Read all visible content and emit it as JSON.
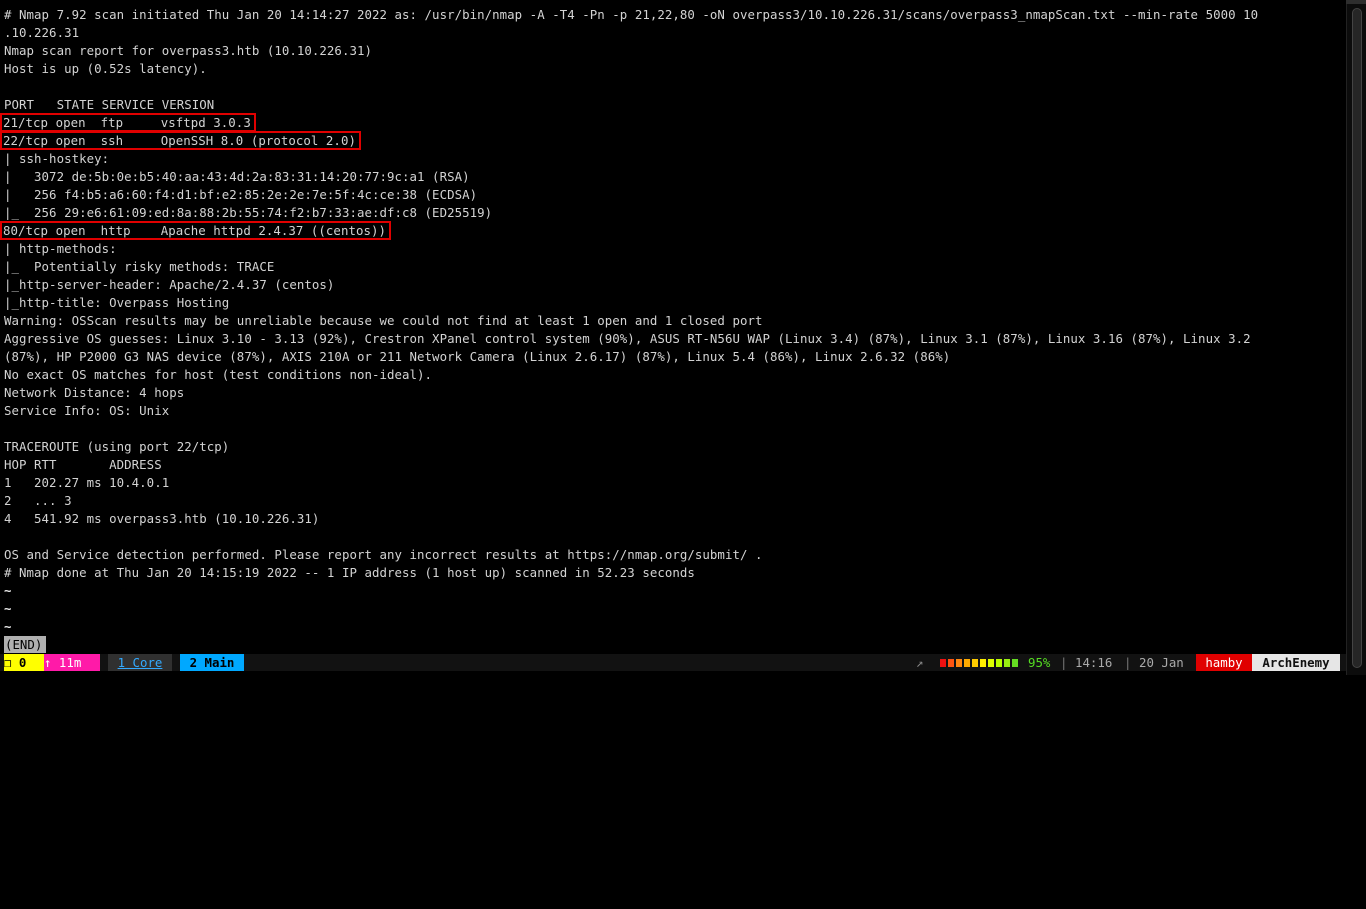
{
  "terminal": {
    "lines": [
      {
        "text": "# Nmap 7.92 scan initiated Thu Jan 20 14:14:27 2022 as: /usr/bin/nmap -A -T4 -Pn -p 21,22,80 -oN overpass3/10.10.226.31/scans/overpass3_nmapScan.txt --min-rate 5000 10",
        "highlight": false
      },
      {
        "text": ".10.226.31",
        "highlight": false
      },
      {
        "text": "Nmap scan report for overpass3.htb (10.10.226.31)",
        "highlight": false
      },
      {
        "text": "Host is up (0.52s latency).",
        "highlight": false
      },
      {
        "text": "",
        "highlight": false
      },
      {
        "text": "PORT   STATE SERVICE VERSION",
        "highlight": false
      },
      {
        "text": "21/tcp open  ftp     vsftpd 3.0.3",
        "highlight": true
      },
      {
        "text": "22/tcp open  ssh     OpenSSH 8.0 (protocol 2.0)",
        "highlight": true
      },
      {
        "text": "| ssh-hostkey: ",
        "highlight": false
      },
      {
        "text": "|   3072 de:5b:0e:b5:40:aa:43:4d:2a:83:31:14:20:77:9c:a1 (RSA)",
        "highlight": false
      },
      {
        "text": "|   256 f4:b5:a6:60:f4:d1:bf:e2:85:2e:2e:7e:5f:4c:ce:38 (ECDSA)",
        "highlight": false
      },
      {
        "text": "|_  256 29:e6:61:09:ed:8a:88:2b:55:74:f2:b7:33:ae:df:c8 (ED25519)",
        "highlight": false
      },
      {
        "text": "80/tcp open  http    Apache httpd 2.4.37 ((centos))",
        "highlight": true
      },
      {
        "text": "| http-methods: ",
        "highlight": false
      },
      {
        "text": "|_  Potentially risky methods: TRACE",
        "highlight": false
      },
      {
        "text": "|_http-server-header: Apache/2.4.37 (centos)",
        "highlight": false
      },
      {
        "text": "|_http-title: Overpass Hosting",
        "highlight": false
      },
      {
        "text": "Warning: OSScan results may be unreliable because we could not find at least 1 open and 1 closed port",
        "highlight": false
      },
      {
        "text": "Aggressive OS guesses: Linux 3.10 - 3.13 (92%), Crestron XPanel control system (90%), ASUS RT-N56U WAP (Linux 3.4) (87%), Linux 3.1 (87%), Linux 3.16 (87%), Linux 3.2",
        "highlight": false
      },
      {
        "text": "(87%), HP P2000 G3 NAS device (87%), AXIS 210A or 211 Network Camera (Linux 2.6.17) (87%), Linux 5.4 (86%), Linux 2.6.32 (86%)",
        "highlight": false
      },
      {
        "text": "No exact OS matches for host (test conditions non-ideal).",
        "highlight": false
      },
      {
        "text": "Network Distance: 4 hops",
        "highlight": false
      },
      {
        "text": "Service Info: OS: Unix",
        "highlight": false
      },
      {
        "text": "",
        "highlight": false
      },
      {
        "text": "TRACEROUTE (using port 22/tcp)",
        "highlight": false
      },
      {
        "text": "HOP RTT       ADDRESS",
        "highlight": false
      },
      {
        "text": "1   202.27 ms 10.4.0.1",
        "highlight": false
      },
      {
        "text": "2   ... 3",
        "highlight": false
      },
      {
        "text": "4   541.92 ms overpass3.htb (10.10.226.31)",
        "highlight": false
      },
      {
        "text": "",
        "highlight": false
      },
      {
        "text": "OS and Service detection performed. Please report any incorrect results at https://nmap.org/submit/ .",
        "highlight": false
      },
      {
        "text": "# Nmap done at Thu Jan 20 14:15:19 2022 -- 1 IP address (1 host up) scanned in 52.23 seconds",
        "highlight": false
      },
      {
        "text": "~",
        "highlight": false,
        "tilde": true
      },
      {
        "text": "~",
        "highlight": false,
        "tilde": true
      },
      {
        "text": "~",
        "highlight": false,
        "tilde": true
      }
    ],
    "pager_status": "(END)"
  },
  "statusbar": {
    "zero_icon": "window-icon",
    "zero_label": "❒ 0",
    "uptime_label": "↑ 11m",
    "window1_label": "1 Core",
    "window2_label": "2 Main",
    "arrow_glyph": "↗",
    "battery_percent": "95%",
    "battery_level": 0.95,
    "battery_cell_colors": [
      "#ee1111",
      "#ff5511",
      "#ff8811",
      "#ffaa00",
      "#ffcc00",
      "#ffee00",
      "#ddff00",
      "#bbff00",
      "#99ee11",
      "#66dd22"
    ],
    "separator": "|",
    "clock": "14:16",
    "date": "20 Jan",
    "hostname": "hamby",
    "session_name": "ArchEnemy"
  }
}
